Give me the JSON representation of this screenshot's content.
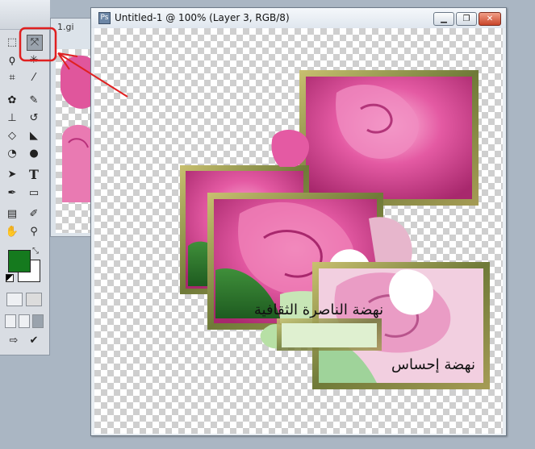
{
  "toolbox": {
    "tools": [
      {
        "name": "rect-marquee-icon",
        "glyph": "⬚"
      },
      {
        "name": "move-tool-icon",
        "glyph": "⤧"
      },
      {
        "name": "lasso-icon",
        "glyph": "ϙ"
      },
      {
        "name": "magic-wand-icon",
        "glyph": "✳"
      },
      {
        "name": "crop-icon",
        "glyph": "⌗"
      },
      {
        "name": "slice-icon",
        "glyph": "⁄"
      },
      {
        "name": "healing-brush-icon",
        "glyph": "✿"
      },
      {
        "name": "brush-icon",
        "glyph": "✎"
      },
      {
        "name": "clone-stamp-icon",
        "glyph": "⊥"
      },
      {
        "name": "history-brush-icon",
        "glyph": "↺"
      },
      {
        "name": "eraser-icon",
        "glyph": "◇"
      },
      {
        "name": "paint-bucket-icon",
        "glyph": "◣"
      },
      {
        "name": "blur-icon",
        "glyph": "◔"
      },
      {
        "name": "dodge-icon",
        "glyph": "●"
      },
      {
        "name": "path-selection-icon",
        "glyph": "➤"
      },
      {
        "name": "type-tool-icon",
        "glyph": "T"
      },
      {
        "name": "pen-tool-icon",
        "glyph": "✒"
      },
      {
        "name": "shape-tool-icon",
        "glyph": "▭"
      },
      {
        "name": "notes-icon",
        "glyph": "▤"
      },
      {
        "name": "eyedropper-icon",
        "glyph": "✐"
      },
      {
        "name": "hand-tool-icon",
        "glyph": "✋"
      },
      {
        "name": "zoom-tool-icon",
        "glyph": "⚲"
      },
      {
        "name": "standard-mode-icon",
        "glyph": "▢"
      },
      {
        "name": "quick-mask-icon",
        "glyph": "◙"
      },
      {
        "name": "screen-mode-standard-icon",
        "glyph": "▣"
      },
      {
        "name": "screen-mode-full-menu-icon",
        "glyph": "▭"
      },
      {
        "name": "screen-mode-full-icon",
        "glyph": "■"
      },
      {
        "name": "jump-to-imageready-icon",
        "glyph": "⇨"
      },
      {
        "name": "jump-edit-icon",
        "glyph": "✔"
      }
    ],
    "foreground_color": "#157a1e",
    "background_color": "#ffffff"
  },
  "background_document": {
    "tab_title": "1.gi"
  },
  "document": {
    "title": "Untitled-1 @ 100% (Layer 3, RGB/8)",
    "minimize_glyph": "▁",
    "restore_glyph": "❐",
    "close_glyph": "✕"
  },
  "canvas_content": {
    "caption_1": "نهضة الناصرة الثقافية",
    "caption_2": "نهضة إحساس"
  },
  "annotation": {
    "highlight_color": "#e02020"
  }
}
